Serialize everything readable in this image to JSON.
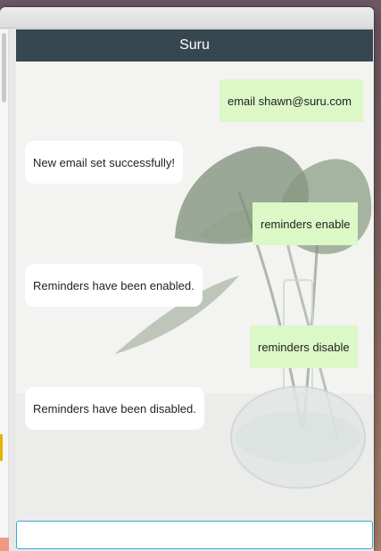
{
  "app": {
    "window_title": ""
  },
  "chat": {
    "title": "Suru",
    "messages": [
      {
        "from": "user",
        "text": "email shawn@suru.com"
      },
      {
        "from": "bot",
        "text": "New email set successfully!"
      },
      {
        "from": "user",
        "text": "reminders enable"
      },
      {
        "from": "bot",
        "text": "Reminders have been enabled."
      },
      {
        "from": "user",
        "text": "reminders disable"
      },
      {
        "from": "bot",
        "text": "Reminders have been disabled."
      }
    ],
    "input": {
      "value": "",
      "placeholder": ""
    }
  },
  "colors": {
    "header": "#36474f",
    "user_bubble": "#dcf8c6",
    "bot_bubble": "#ffffff",
    "input_border": "#38a9d6"
  },
  "icons": [
    "plant-vase-background"
  ]
}
